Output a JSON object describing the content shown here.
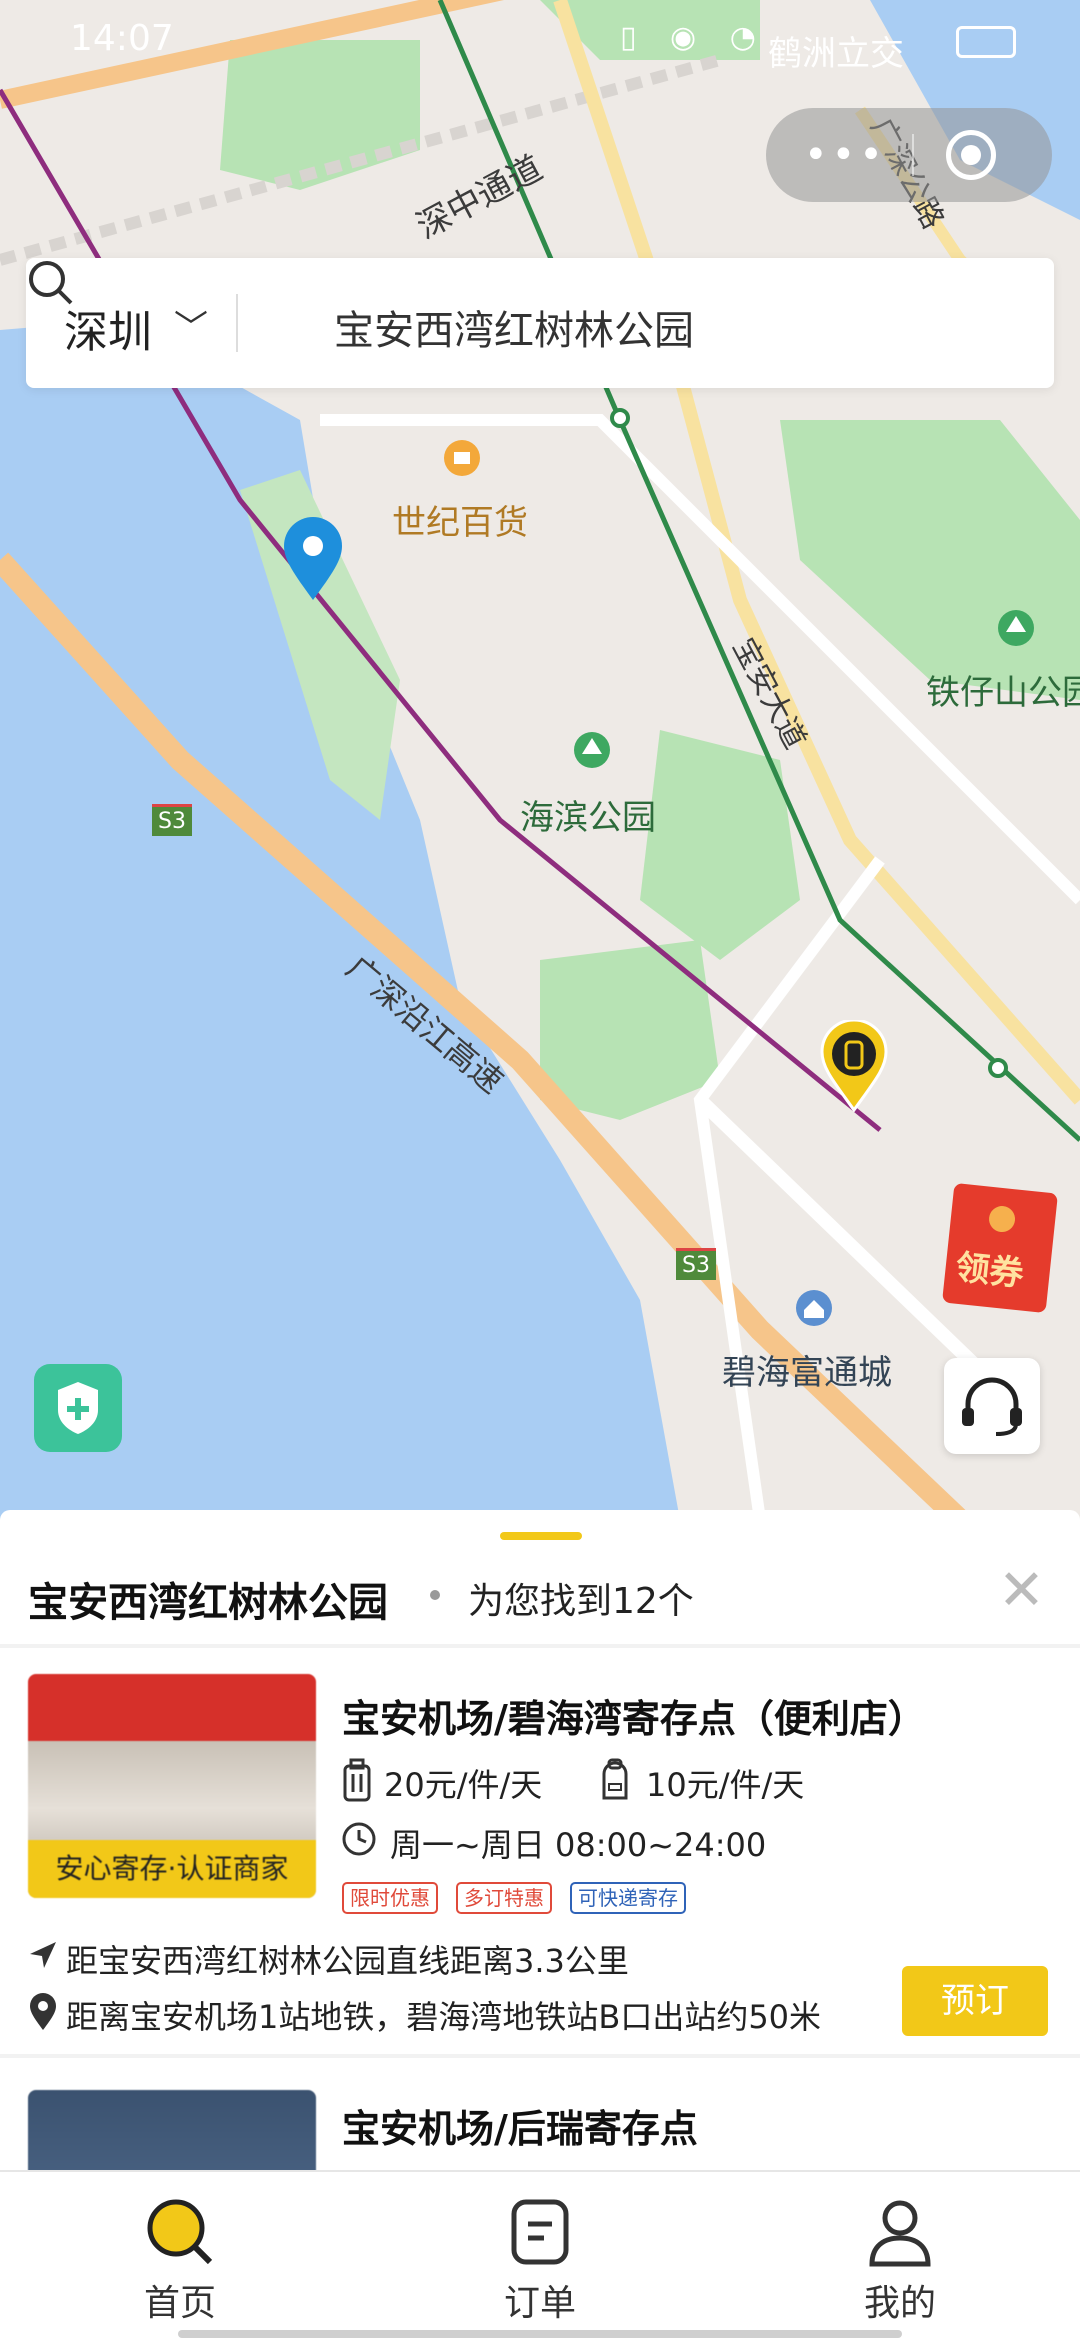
{
  "status_bar": {
    "time": "14:07",
    "carrier": "鹤洲立交"
  },
  "search": {
    "city": "深圳",
    "query": "宝安西湾红树林公园"
  },
  "map": {
    "labels": {
      "shenzhong": "深中通道",
      "guangshen_road": "广深公路",
      "shiji": "世纪百货",
      "tiezaishan": "铁仔山公园",
      "haibin": "海滨公园",
      "baoan_ave": "宝安大道",
      "expressway": "广深沿江高速",
      "bihai": "碧海富通城",
      "s3_a": "S3",
      "s3_b": "S3"
    },
    "coupon": "领券",
    "colors": {
      "water": "#a9cdf3",
      "green": "#b7e3b4",
      "road": "#f6c58a",
      "metro_purple": "#8e2d7e",
      "metro_green": "#2f8a4a"
    }
  },
  "results": {
    "title": "宝安西湾红树林公园",
    "count_text": "为您找到12个",
    "close": "✕"
  },
  "cards": [
    {
      "title": "宝安机场/碧海湾寄存点（便利店）",
      "badge": "安心寄存·认证商家",
      "price_luggage": "20元/件/天",
      "price_bag": "10元/件/天",
      "hours": "周一~周日 08:00~24:00",
      "tags": [
        "限时优惠",
        "多订特惠",
        "可快递寄存"
      ],
      "distance_line": "距宝安西湾红树林公园直线距离3.3公里",
      "metro_line": "距离宝安机场1站地铁，碧海湾地铁站B口出站约50米",
      "book": "预订"
    },
    {
      "title": "宝安机场/后瑞寄存点"
    }
  ],
  "tabs": [
    {
      "label": "首页",
      "icon": "search-icon"
    },
    {
      "label": "订单",
      "icon": "order-icon"
    },
    {
      "label": "我的",
      "icon": "profile-icon"
    }
  ],
  "accent": "#f2c818"
}
